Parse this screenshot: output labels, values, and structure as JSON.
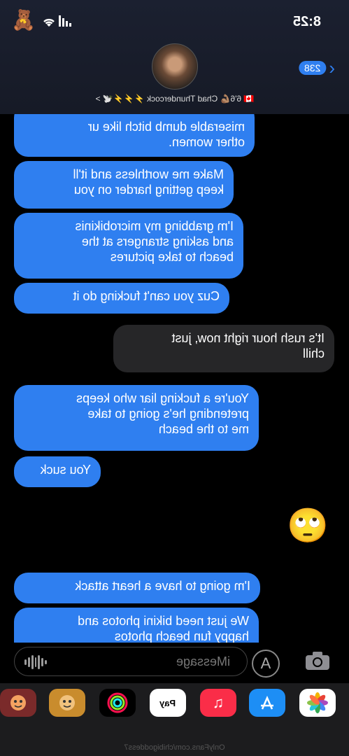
{
  "status_bar": {
    "time": "8:25"
  },
  "header": {
    "unread_count": "238",
    "contact_name": "🇨🇦 6'6💪🏽 Chad Thundercock ⚡️⚡️⚡️🕊️ >"
  },
  "messages": [
    {
      "side": "received",
      "text": "miserable dumb bitch like ur\nother women."
    },
    {
      "side": "received",
      "text": "Make me worthless and it'll\nkeep getting harder on you"
    },
    {
      "side": "received",
      "text": "I'm grabbing my microbikinis\nand asking strangers at the\nbeach to take pictures"
    },
    {
      "side": "received",
      "text": "Cuz you can't fucking do it"
    },
    {
      "side": "sent",
      "text": "It's rush hour right now, just\nchill"
    },
    {
      "side": "received",
      "text": "You're a fucking liar who keeps\npretending he's going to take\nme to the beach"
    },
    {
      "side": "received",
      "text": "You suck"
    },
    {
      "side": "sent",
      "text": "🙄"
    },
    {
      "side": "received",
      "text": "I'm going to have a heart attack"
    },
    {
      "side": "received",
      "text": "We just need bikini photos and\nhappy fun beach photos"
    }
  ],
  "compose": {
    "placeholder": "iMessage"
  },
  "dock": {
    "apple_pay_label": "Pay"
  },
  "footer": {
    "watermark": "OnlyFans.com/chibigoddess7"
  },
  "colors": {
    "imessage_blue": "#2f7ff0",
    "sent_gray": "#262628",
    "background": "#000000"
  },
  "icons": [
    "bear-emoji-icon",
    "wifi-icon",
    "signal-icon",
    "back-chevron-icon",
    "camera-icon",
    "app-store-icon",
    "audio-waveform-icon",
    "photos-icon",
    "music-icon",
    "apple-pay-icon",
    "activity-icon",
    "memoji-icon"
  ]
}
